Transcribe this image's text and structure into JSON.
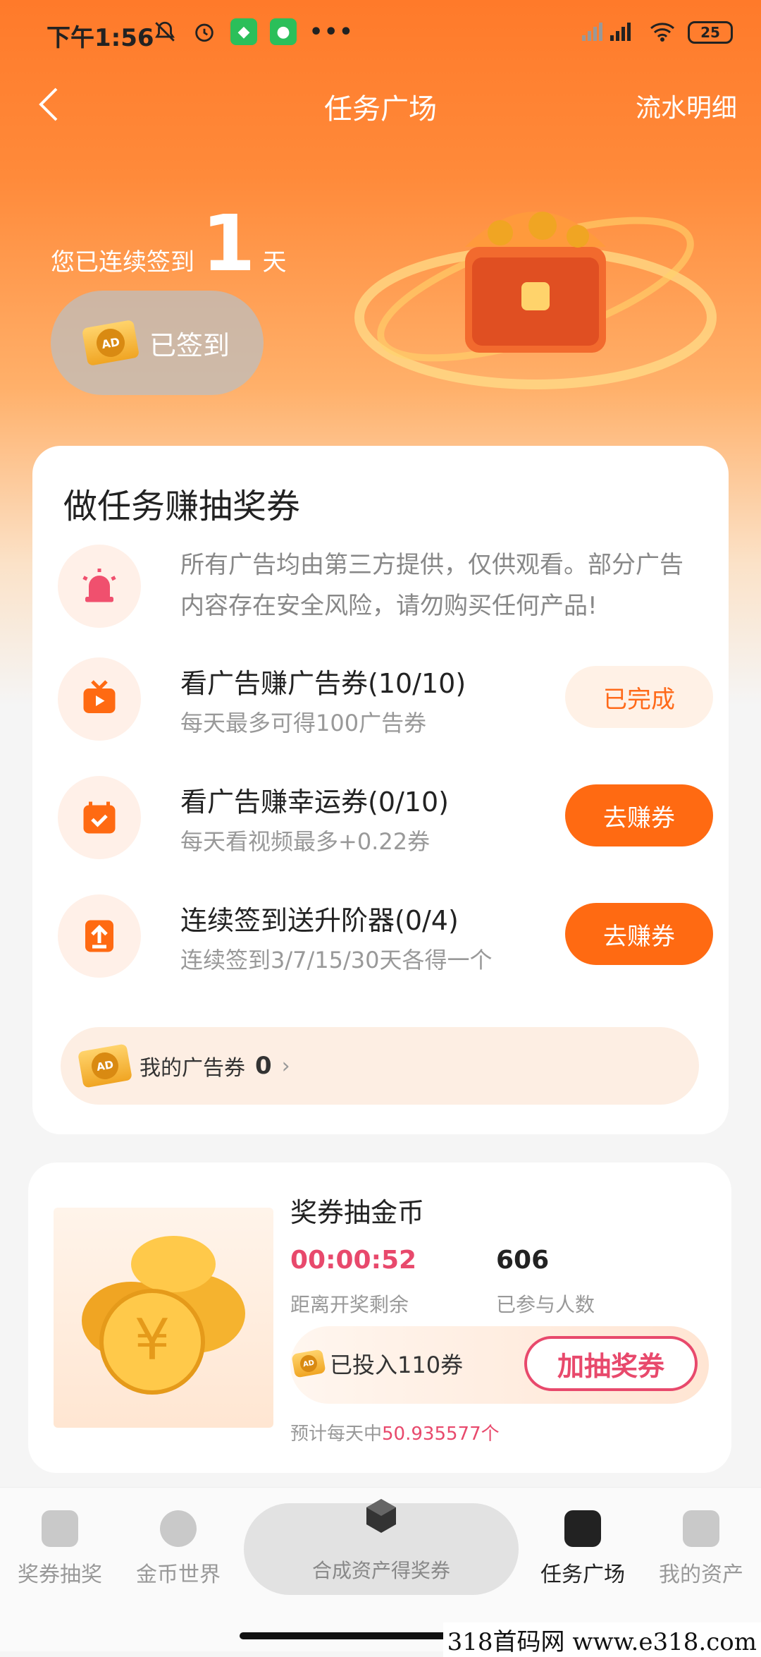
{
  "status_bar": {
    "time": "下午1:56",
    "more": "•••",
    "battery": "25"
  },
  "nav": {
    "title": "任务广场",
    "right_link": "流水明细"
  },
  "checkin": {
    "prefix": "您已连续签到",
    "days": "1",
    "suffix": "天",
    "button_label": "已签到"
  },
  "task_card": {
    "header": "做任务赚抽奖券",
    "notice": "所有广告均由第三方提供，仅供观看。部分广告内容存在安全风险，请勿购买任何产品!",
    "tasks": [
      {
        "title": "看广告赚广告券(10/10)",
        "desc": "每天最多可得100广告券",
        "button": "已完成",
        "icon": "tv-play-icon"
      },
      {
        "title": "看广告赚幸运券(0/10)",
        "desc": "每天看视频最多+0.22券",
        "button": "去赚券",
        "icon": "calendar-check-icon"
      },
      {
        "title": "连续签到送升阶器(0/4)",
        "desc": "连续签到3/7/15/30天各得一个",
        "button": "去赚券",
        "icon": "upload-arrow-icon"
      }
    ],
    "my_tickets_label": "我的广告券",
    "my_tickets_count": "0",
    "arrow": "›"
  },
  "draw_card": {
    "title": "奖券抽金币",
    "timer": "00:00:52",
    "timer_label": "距离开奖剩余",
    "participants": "606",
    "participants_label": "已参与人数",
    "invested": "已投入110券",
    "add_button": "加抽奖券",
    "forecast_prefix": "预计每天中",
    "forecast_value": "50.935577个"
  },
  "tabbar": {
    "tabs": [
      {
        "label": "奖券抽奖",
        "active": false
      },
      {
        "label": "金币世界",
        "active": false
      },
      {
        "label": "合成资产得奖券",
        "active": false
      },
      {
        "label": "任务广场",
        "active": true
      },
      {
        "label": "我的资产",
        "active": false
      }
    ]
  },
  "watermark": "318首码网  www.e318.com",
  "colors": {
    "accent": "#ff6a12",
    "pink": "#e8496c",
    "header_gradient_top": "#ff7a2a"
  }
}
